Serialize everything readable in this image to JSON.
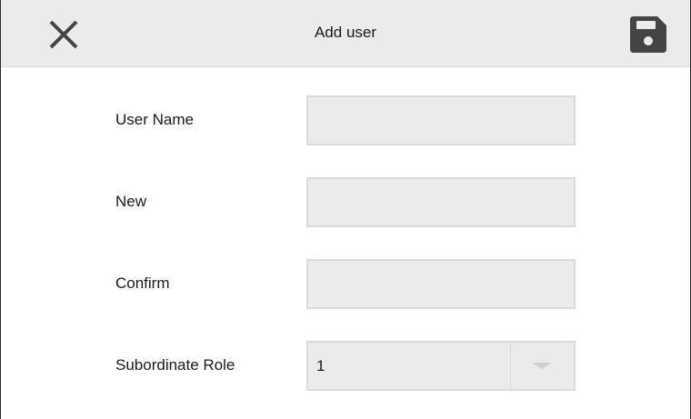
{
  "header": {
    "title": "Add user",
    "close_icon": "close-icon",
    "save_icon": "save-icon"
  },
  "form": {
    "fields": [
      {
        "label": "User Name",
        "value": "",
        "placeholder": ""
      },
      {
        "label": "New",
        "value": "",
        "placeholder": ""
      },
      {
        "label": "Confirm",
        "value": "",
        "placeholder": ""
      }
    ],
    "role": {
      "label": "Subordinate Role",
      "selected": "1"
    }
  },
  "colors": {
    "header_bg": "#ebebeb",
    "field_bg": "#ebebeb",
    "field_border": "#dadada",
    "icon": "#444444"
  }
}
